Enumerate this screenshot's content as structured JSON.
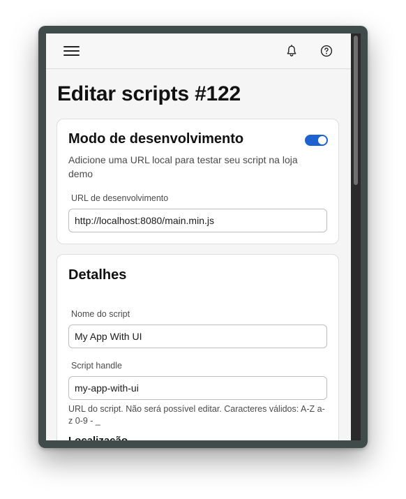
{
  "header": {
    "menu_icon": "hamburger-menu-icon",
    "notifications_icon": "bell-icon",
    "help_icon": "question-circle-icon"
  },
  "page": {
    "title": "Editar scripts #122"
  },
  "dev_mode": {
    "title": "Modo de desenvolvimento",
    "enabled": true,
    "description": "Adicione uma URL local para testar seu script na loja demo",
    "url_label": "URL de desenvolvimento",
    "url_value": "http://localhost:8080/main.min.js"
  },
  "details": {
    "title": "Detalhes",
    "name_label": "Nome do script",
    "name_value": "My App With UI",
    "handle_label": "Script handle",
    "handle_value": "my-app-with-ui",
    "handle_help": "URL do script. Não será possível editar. Caracteres válidos: A-Z a-z 0-9 - _",
    "next_section_partial": "Localização"
  },
  "colors": {
    "accent": "#1e62d0",
    "window_frame": "#3f4c49",
    "page_background": "#f5f5f5"
  }
}
